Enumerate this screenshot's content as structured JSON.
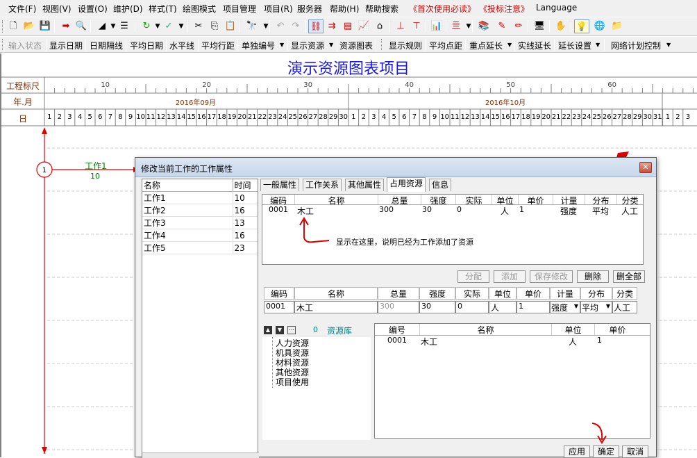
{
  "menu": [
    "文件(F)",
    "视图(V)",
    "设置(O)",
    "维护(D)",
    "样式(T)",
    "绘图模式",
    "项目管理",
    "项目(R)",
    "服务器",
    "帮助(H)",
    "帮助搜索",
    "《首次使用必读》",
    "《投标注意》",
    "Language"
  ],
  "toolbar2": [
    "输入状态",
    "显示日期",
    "日期隔线",
    "平均日期",
    "水平线",
    "平均行距",
    "单独编号",
    "显示资源",
    "资源图表",
    "显示规则",
    "平均点距",
    "重点延长",
    "实线延长",
    "延长设置",
    "网络计划控制"
  ],
  "project_title": "演示资源图表项目",
  "timescale": {
    "row_labels": [
      "工程标尺",
      "年.月",
      "日"
    ],
    "scale_ticks": [
      "10",
      "20",
      "30",
      "40",
      "50",
      "60"
    ],
    "months": [
      "2016年09月",
      "2016年10月"
    ],
    "days_sep": [
      "1",
      "2",
      "3",
      "4",
      "5",
      "6",
      "7",
      "8",
      "9",
      "10",
      "11",
      "12",
      "13",
      "14",
      "15",
      "16",
      "17",
      "18",
      "19",
      "20",
      "21",
      "22",
      "23",
      "24",
      "25",
      "26",
      "27",
      "28",
      "29",
      "30"
    ],
    "days_oct": [
      "1",
      "2",
      "3",
      "4",
      "5",
      "6",
      "7",
      "8",
      "9",
      "10",
      "11",
      "12",
      "13",
      "14",
      "15",
      "16",
      "17",
      "18",
      "19",
      "20",
      "21",
      "22",
      "23",
      "24",
      "25",
      "26",
      "27",
      "28",
      "29",
      "30",
      "31"
    ],
    "days_nov": [
      "1",
      "2",
      "3"
    ]
  },
  "network": {
    "node_label": "1",
    "activity_name": "工作1",
    "activity_duration": "10"
  },
  "dialog": {
    "title": "修改当前工作的工作属性",
    "task_headers": [
      "名称",
      "时间"
    ],
    "tasks": [
      {
        "name": "工作1",
        "time": "10"
      },
      {
        "name": "工作2",
        "time": "16"
      },
      {
        "name": "工作3",
        "time": "13"
      },
      {
        "name": "工作4",
        "time": "16"
      },
      {
        "name": "工作5",
        "time": "23"
      }
    ],
    "tabs": [
      "一般属性",
      "工作关系",
      "其他属性",
      "占用资源",
      "信息"
    ],
    "resource_headers": [
      "编码",
      "名称",
      "总量",
      "强度",
      "实际",
      "单位",
      "单价",
      "计量",
      "分布",
      "分类"
    ],
    "resource_row": [
      "0001",
      "木工",
      "300",
      "30",
      "0",
      "人",
      "1",
      "强度",
      "平均",
      "人工"
    ],
    "annotation": "显示在这里，说明已经为工作添加了资源",
    "buttons_mid": [
      "分配",
      "添加",
      "保存修改",
      "删除",
      "删全部"
    ],
    "edit_row": {
      "code": "0001",
      "name": "木工",
      "total": "300",
      "intensity": "30",
      "actual": "0",
      "unit": "人",
      "price": "1",
      "measure": "强度",
      "dist": "平均",
      "category": "人工"
    },
    "library_count": "0",
    "library_label": "资源库",
    "tree": [
      "人力资源",
      "机具资源",
      "材料资源",
      "其他资源",
      "项目使用"
    ],
    "lib_headers": [
      "编号",
      "名称",
      "单位",
      "单价"
    ],
    "lib_row": [
      "0001",
      "木工",
      "人",
      "1"
    ],
    "buttons_bottom": [
      "应用",
      "确定",
      "取消"
    ]
  },
  "colors": {
    "title_blue": "#1a1ae6",
    "arrow_red": "#e00000",
    "label_green": "#008000"
  }
}
